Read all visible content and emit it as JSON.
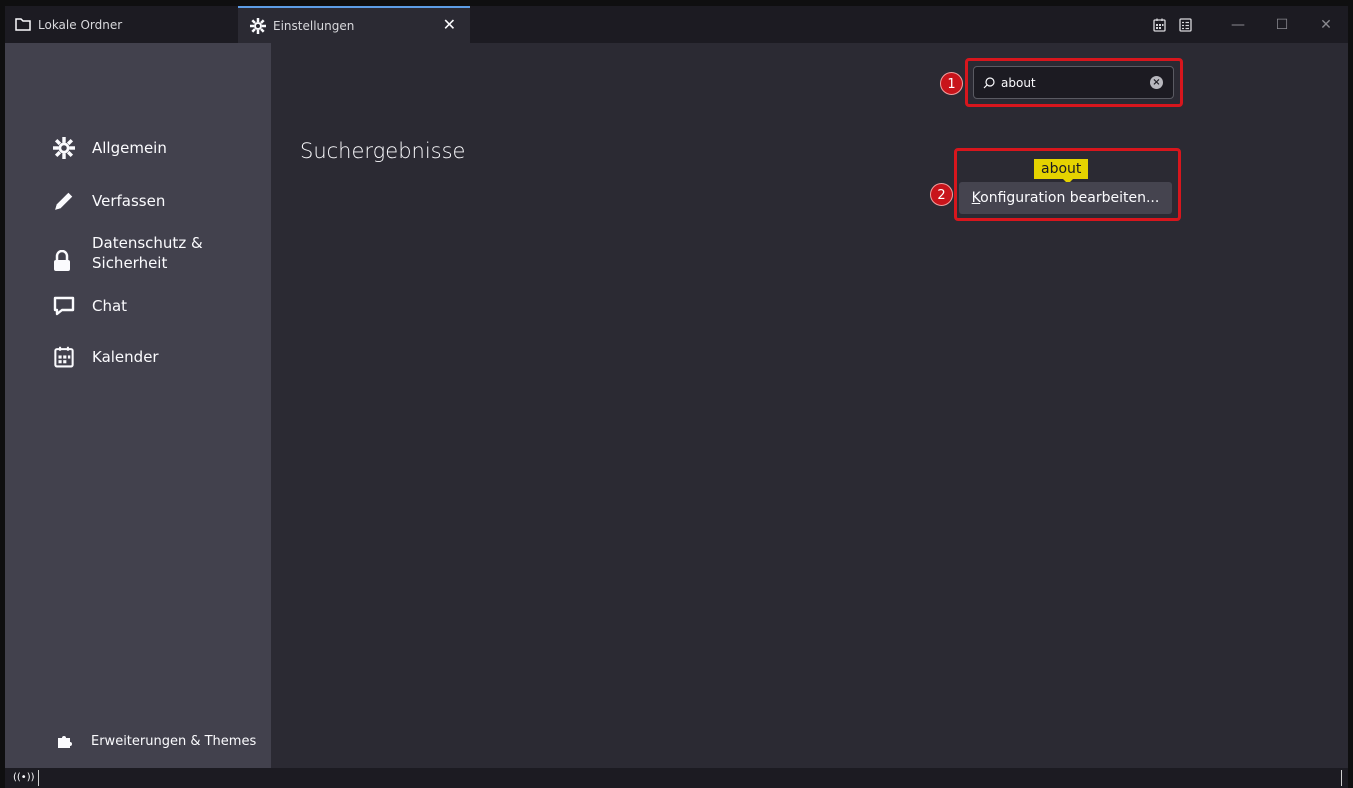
{
  "tabs": [
    {
      "label": "Lokale Ordner",
      "icon": "folder-icon"
    },
    {
      "label": "Einstellungen",
      "icon": "gear-icon",
      "close": "✕"
    }
  ],
  "window_controls": {
    "minimize": "—",
    "maximize": "☐",
    "close": "✕"
  },
  "sidebar": {
    "items": [
      {
        "label": "Allgemein",
        "icon": "gear-icon"
      },
      {
        "label": "Verfassen",
        "icon": "pencil-icon"
      },
      {
        "label_line1": "Datenschutz &",
        "label_line2": "Sicherheit",
        "icon": "lock-icon"
      },
      {
        "label": "Chat",
        "icon": "chat-icon"
      },
      {
        "label": "Kalender",
        "icon": "calendar-icon"
      }
    ],
    "extensions": {
      "label": "Erweiterungen & Themes",
      "icon": "puzzle-icon"
    }
  },
  "main": {
    "heading": "Suchergebnisse",
    "search": {
      "value": "about"
    },
    "tooltip": "about",
    "config_button": {
      "accesskey": "K",
      "rest": "onfiguration bearbeiten..."
    }
  },
  "annotations": {
    "badge1": "1",
    "badge2": "2",
    "color": "#d7161d"
  },
  "status": {
    "icon": "wifi-signal-icon",
    "text": "((•))"
  }
}
